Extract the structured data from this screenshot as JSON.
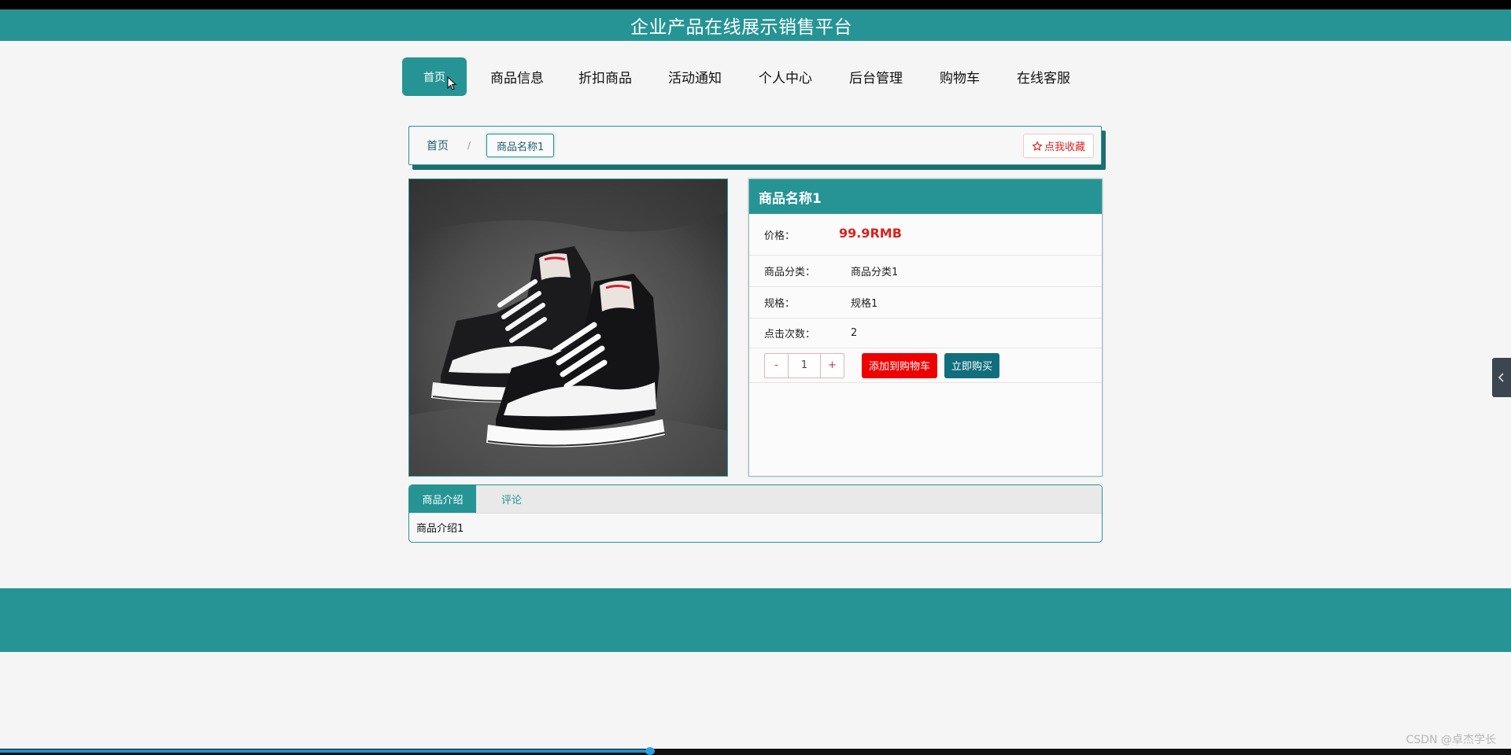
{
  "header": {
    "title": "企业产品在线展示销售平台"
  },
  "nav": {
    "items": [
      {
        "label": "首页"
      },
      {
        "label": "商品信息"
      },
      {
        "label": "折扣商品"
      },
      {
        "label": "活动通知"
      },
      {
        "label": "个人中心"
      },
      {
        "label": "后台管理"
      },
      {
        "label": "购物车"
      },
      {
        "label": "在线客服"
      }
    ]
  },
  "breadcrumb": {
    "home": "首页",
    "separator": "/",
    "current": "商品名称1",
    "favorite_label": "点我收藏"
  },
  "product": {
    "name": "商品名称1",
    "price_label": "价格：",
    "price_value": "99.9RMB",
    "category_label": "商品分类：",
    "category_value": "商品分类1",
    "spec_label": "规格：",
    "spec_value": "规格1",
    "clicks_label": "点击次数：",
    "clicks_value": "2",
    "quantity": "1",
    "minus_label": "-",
    "plus_label": "+",
    "add_to_cart_label": "添加到购物车",
    "buy_now_label": "立即购买"
  },
  "tabs": {
    "items": [
      {
        "label": "商品介绍"
      },
      {
        "label": "评论"
      }
    ],
    "content": "商品介绍1"
  },
  "watermark": "CSDN @卓杰学长",
  "colors": {
    "primary": "#269494",
    "price": "#d9231f",
    "cart_button": "#ef0000",
    "buy_button": "#116e7c"
  }
}
